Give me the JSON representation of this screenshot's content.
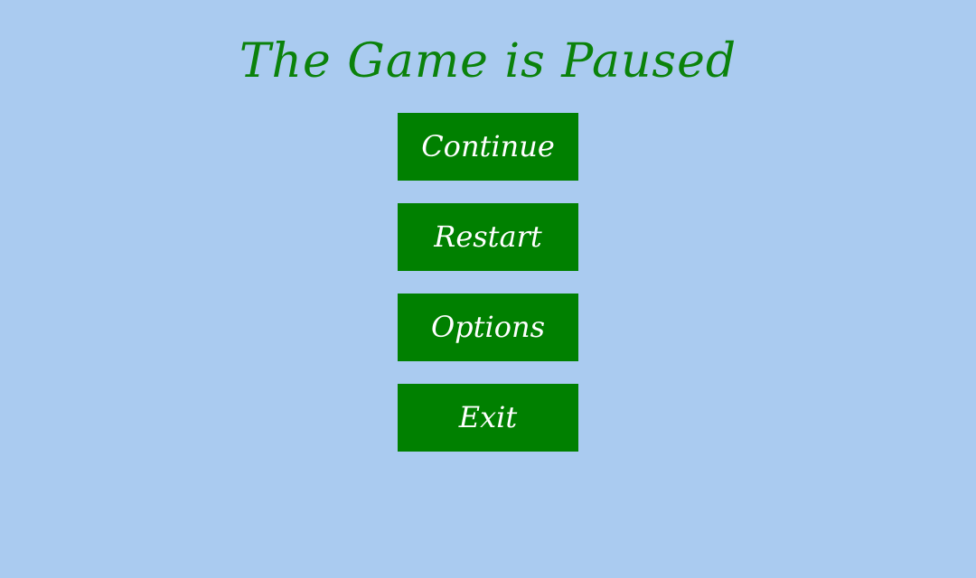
{
  "colors": {
    "background": "#aacbf0",
    "title": "#0b820b",
    "button_bg": "#008000",
    "button_text": "#ffffff"
  },
  "title": "The Game is Paused",
  "menu": {
    "continue_label": "Continue",
    "restart_label": "Restart",
    "options_label": "Options",
    "exit_label": "Exit"
  }
}
